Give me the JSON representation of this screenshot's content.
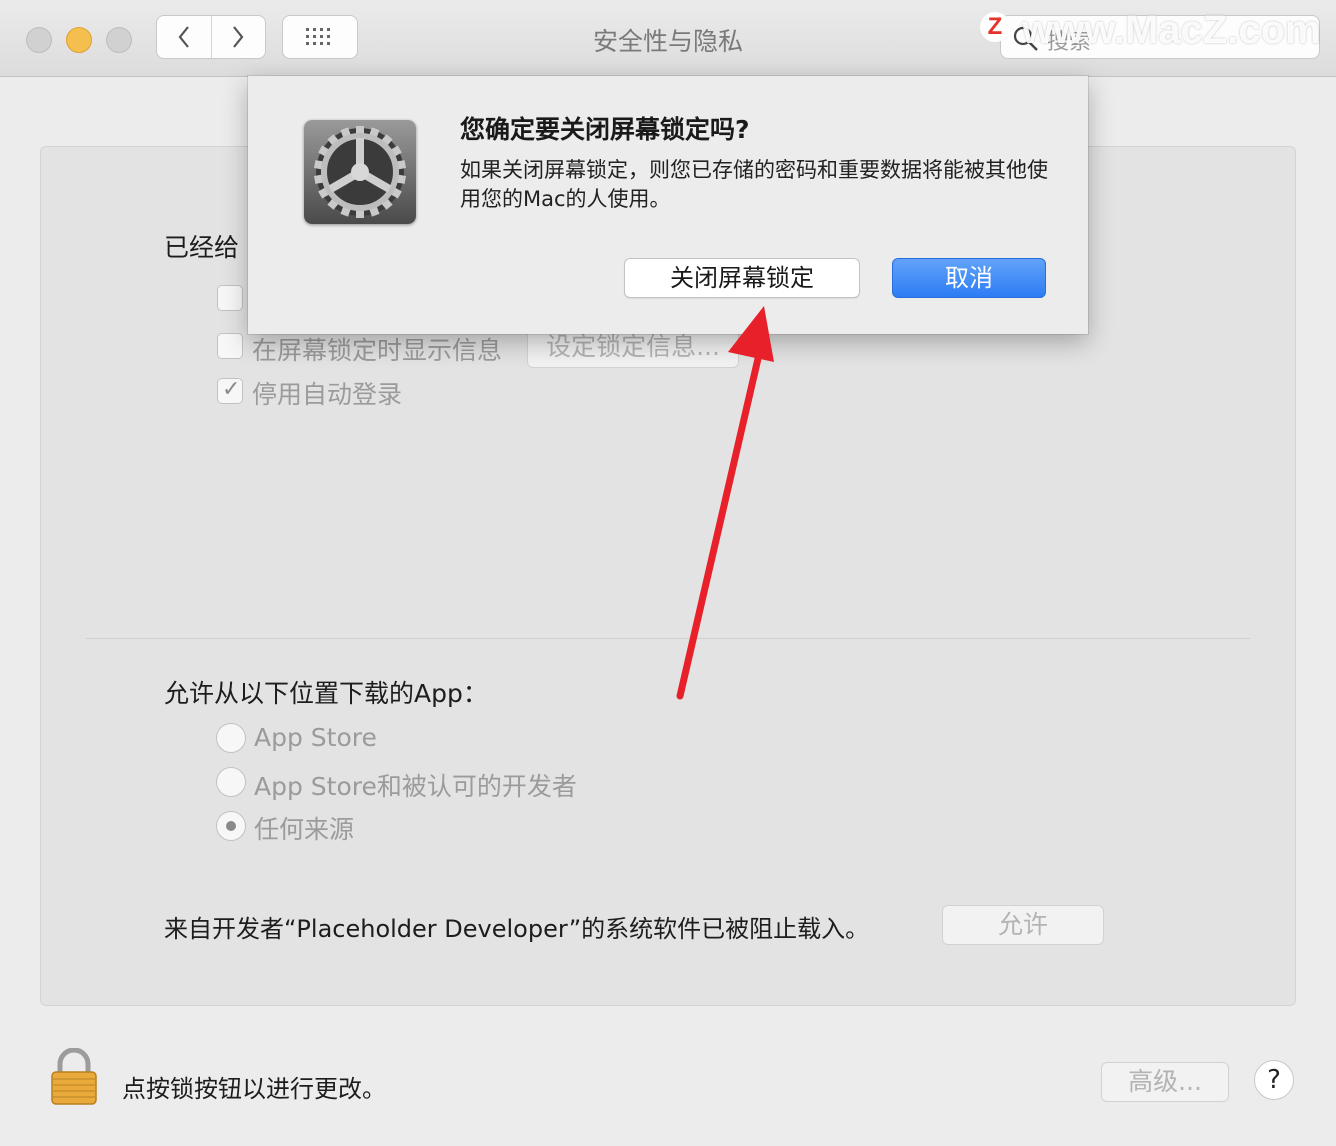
{
  "window": {
    "title": "安全性与隐私",
    "search_placeholder": "搜索",
    "watermark": "www.MacZ.com",
    "watermark_logo": "Z"
  },
  "general": {
    "heading_partial": "已经给",
    "show_message_label": "在屏幕锁定时显示信息",
    "set_lock_message_button": "设定锁定信息...",
    "disable_auto_login_label": "停用自动登录",
    "disable_auto_login_checked": true
  },
  "downloads": {
    "heading": "允许从以下位置下载的App：",
    "options": [
      {
        "label": "App Store",
        "selected": false
      },
      {
        "label": "App Store和被认可的开发者",
        "selected": false
      },
      {
        "label": "任何来源",
        "selected": true
      }
    ],
    "blocked_message": "来自开发者“Placeholder Developer”的系统软件已被阻止载入。",
    "allow_button": "允许"
  },
  "footer": {
    "lock_message": "点按锁按钮以进行更改。",
    "advanced_button": "高级...",
    "help_button": "?"
  },
  "dialog": {
    "title": "您确定要关闭屏幕锁定吗?",
    "message": "如果关闭屏幕锁定，则您已存储的密码和重要数据将能被其他使用您的Mac的人使用。",
    "confirm_button": "关闭屏幕锁定",
    "cancel_button": "取消"
  },
  "colors": {
    "accent": "#2d7cf5",
    "annotation_arrow": "#e8202a",
    "minimize_light": "#f5bf4f"
  }
}
